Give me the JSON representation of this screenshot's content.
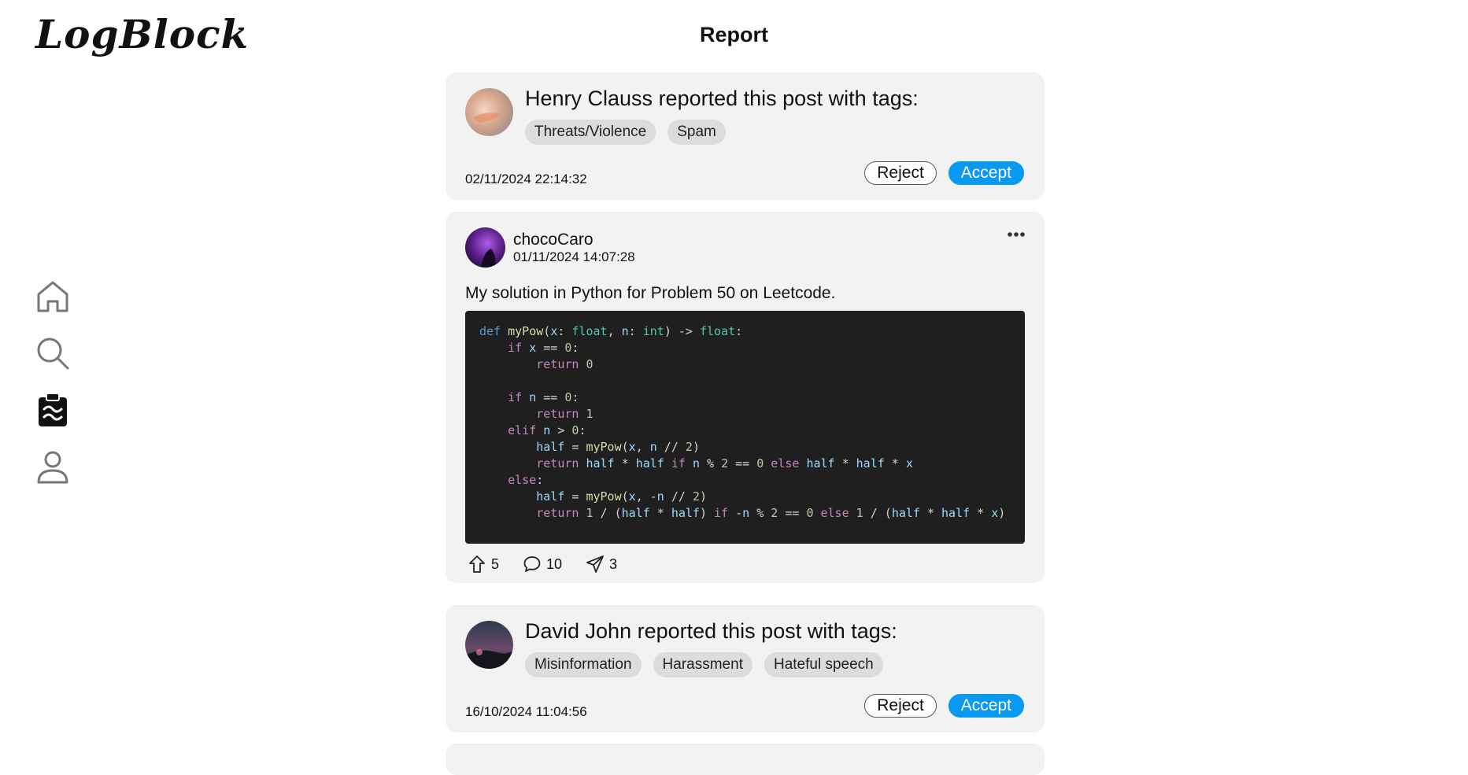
{
  "app": {
    "logo": "LogBlock",
    "page_title": "Report"
  },
  "sidebar": {
    "items": [
      {
        "icon": "home-icon"
      },
      {
        "icon": "search-icon"
      },
      {
        "icon": "report-icon",
        "active": true
      },
      {
        "icon": "profile-icon"
      }
    ]
  },
  "reports": [
    {
      "reporter": "Henry Clauss",
      "suffix": " reported this post with tags:",
      "tags": [
        "Threats/Violence",
        "Spam"
      ],
      "timestamp": "02/11/2024 22:14:32",
      "reject_label": "Reject",
      "accept_label": "Accept"
    },
    {
      "reporter": "David John",
      "suffix": " reported this post with tags:",
      "tags": [
        "Misinformation",
        "Harassment",
        "Hateful speech"
      ],
      "timestamp": "16/10/2024 11:04:56",
      "reject_label": "Reject",
      "accept_label": "Accept"
    }
  ],
  "post": {
    "author": "chocoCaro",
    "date": "01/11/2024 14:07:28",
    "text": "My solution in Python for Problem 50 on Leetcode.",
    "code_language": "Python",
    "upvotes": "5",
    "comments": "10",
    "shares": "3"
  },
  "colors": {
    "accent": "#0a99f0",
    "card_bg": "#f2f2f2",
    "tag_bg": "#dcdcdc",
    "code_bg": "#1f1f1f"
  }
}
